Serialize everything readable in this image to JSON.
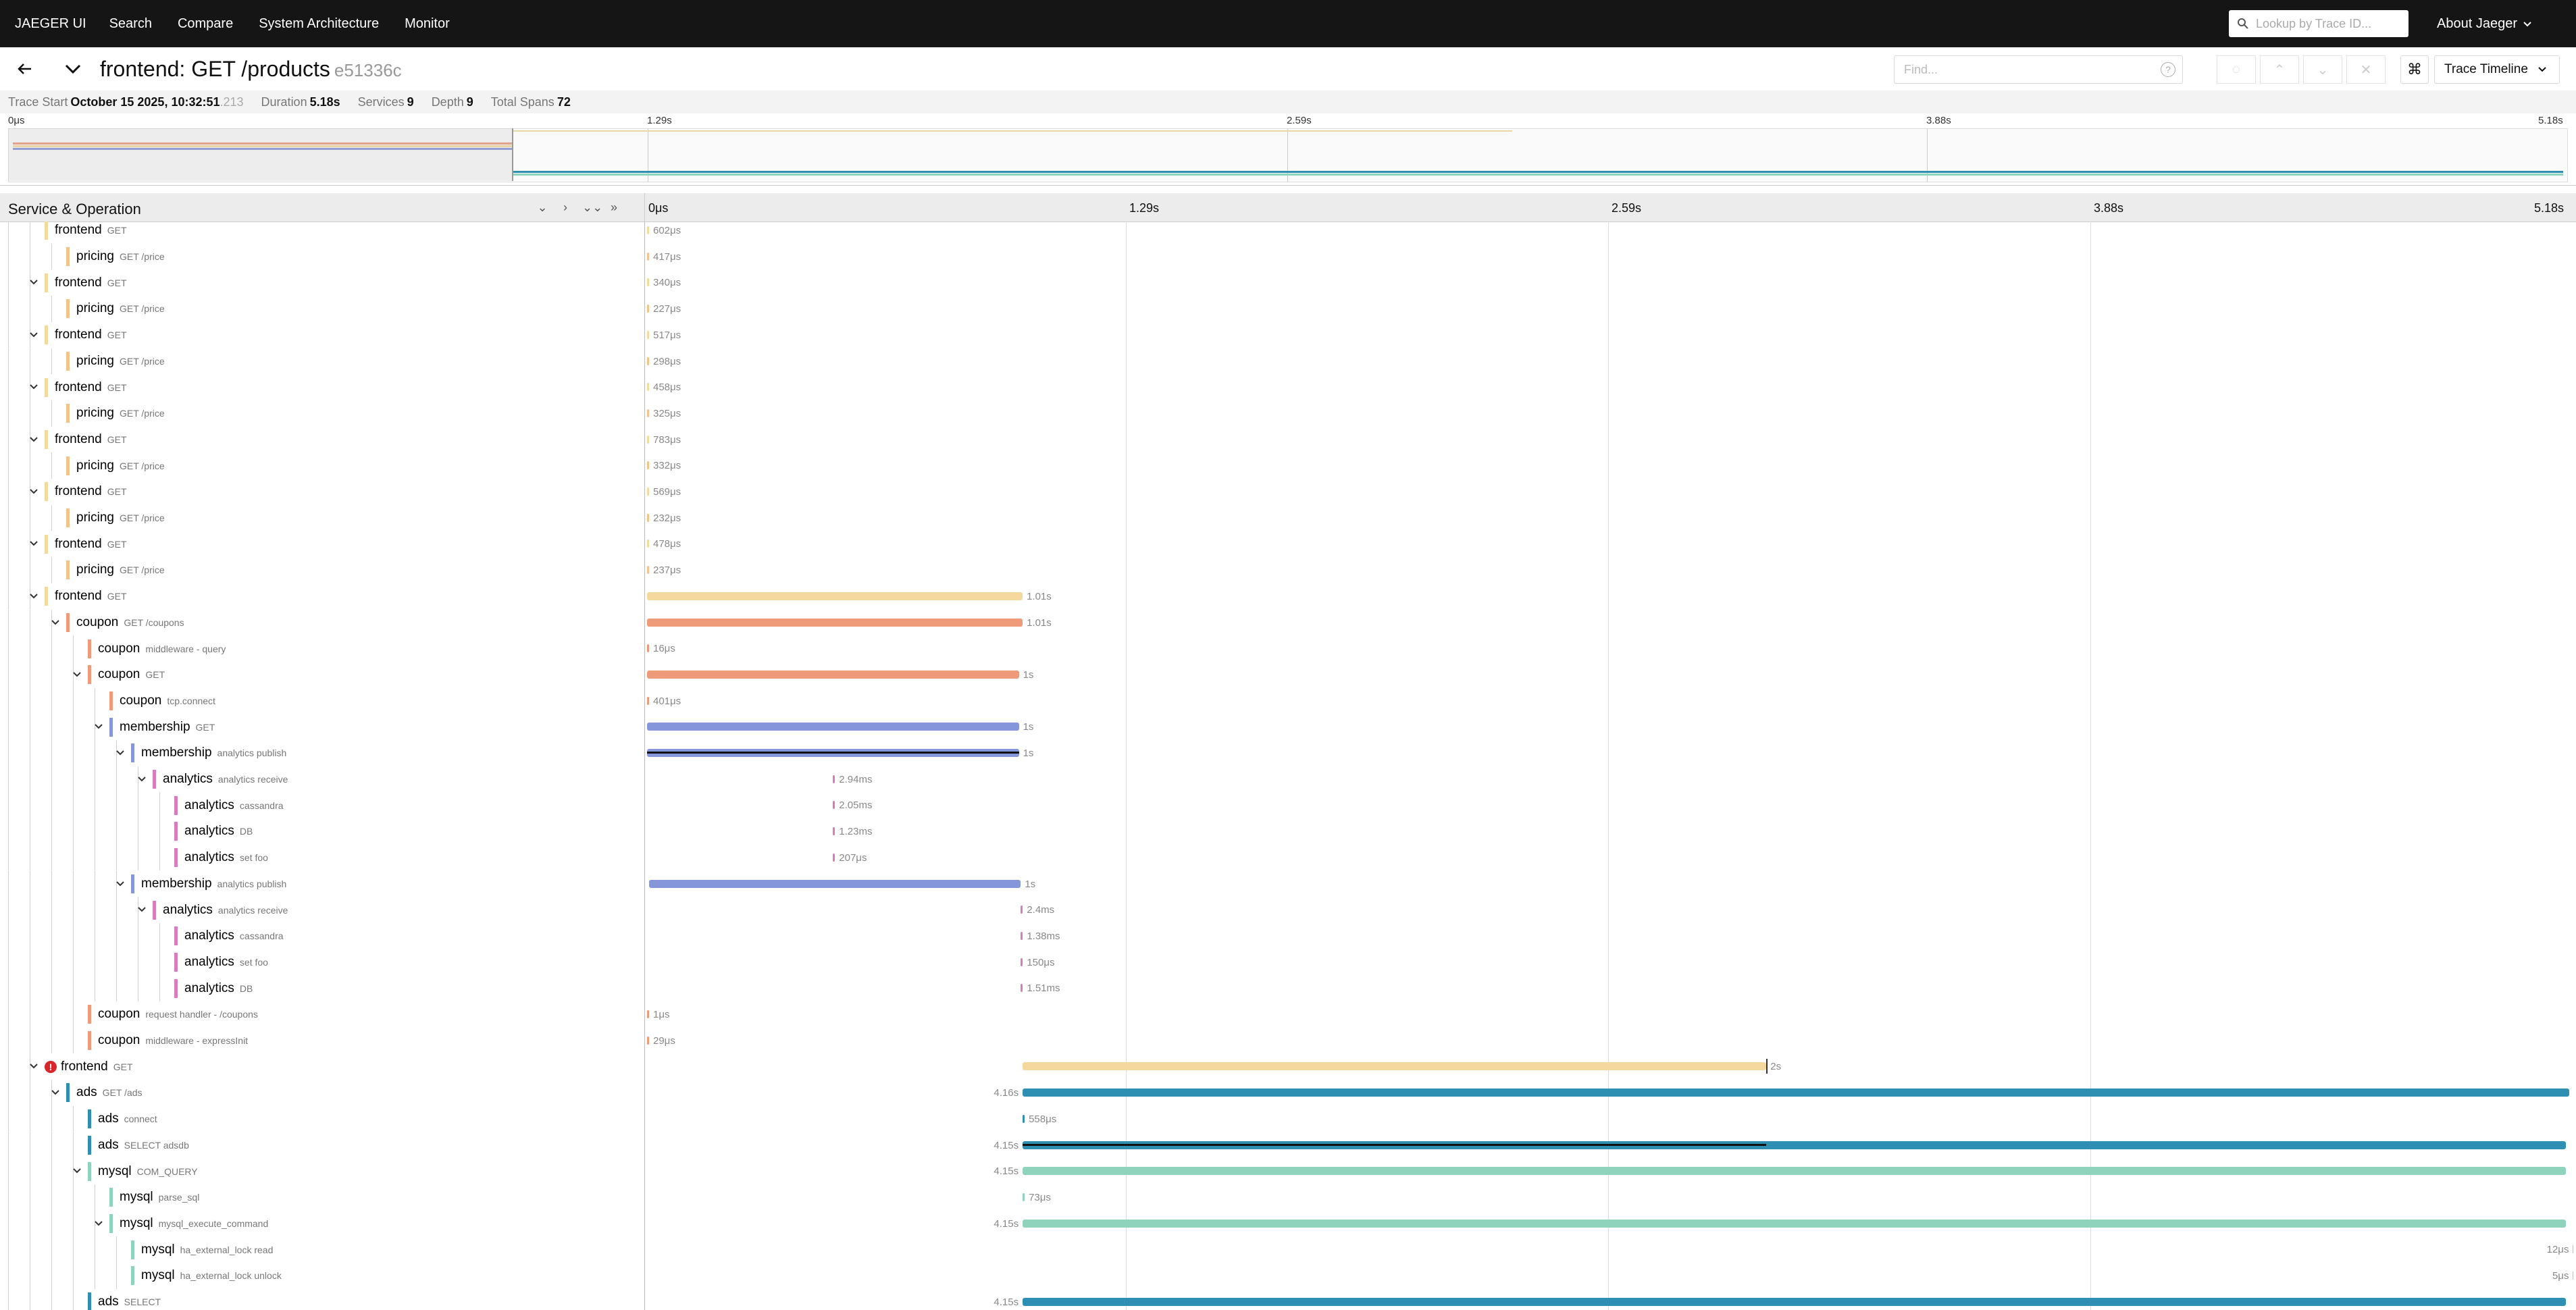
{
  "nav": {
    "brand": "JAEGER UI",
    "links": [
      "Search",
      "Compare",
      "System Architecture",
      "Monitor"
    ],
    "lookup_placeholder": "Lookup by Trace ID...",
    "about": "About Jaeger"
  },
  "trace": {
    "title": "frontend: GET /products",
    "trace_id": "e51336c",
    "find_placeholder": "Find...",
    "view_mode": "Trace Timeline"
  },
  "summary": {
    "trace_start_label": "Trace Start",
    "trace_start_value": "October 15 2025, 10:32:51",
    "trace_start_ms": ".213",
    "duration_label": "Duration",
    "duration_value": "5.18s",
    "services_label": "Services",
    "services_value": "9",
    "depth_label": "Depth",
    "depth_value": "9",
    "total_spans_label": "Total Spans",
    "total_spans_value": "72"
  },
  "timeline": {
    "ticks": [
      "0μs",
      "1.29s",
      "2.59s",
      "3.88s",
      "5.18s"
    ],
    "column_label": "Service & Operation",
    "total_seconds": 5.18
  },
  "colors": {
    "frontend": "#f5d89e",
    "pricing": "#f3c38a",
    "coupon": "#ef9b7a",
    "membership": "#8596db",
    "analytics": "#d97bc0",
    "ads": "#2e8fb3",
    "mysql": "#8fd3bd"
  },
  "rows": [
    {
      "service": "frontend",
      "op": "GET",
      "depth": 2,
      "toggle": "none",
      "start": 0.0,
      "dur_s": 0.000602,
      "label": "602μs",
      "clip": true
    },
    {
      "service": "pricing",
      "op": "GET /price",
      "depth": 3,
      "toggle": "none",
      "start": 0.0,
      "dur_s": 0.000417,
      "label": "417μs"
    },
    {
      "service": "frontend",
      "op": "GET",
      "depth": 2,
      "toggle": "open",
      "start": 0.0,
      "dur_s": 0.00034,
      "label": "340μs"
    },
    {
      "service": "pricing",
      "op": "GET /price",
      "depth": 3,
      "toggle": "none",
      "start": 0.0,
      "dur_s": 0.000227,
      "label": "227μs"
    },
    {
      "service": "frontend",
      "op": "GET",
      "depth": 2,
      "toggle": "open",
      "start": 0.0,
      "dur_s": 0.000517,
      "label": "517μs"
    },
    {
      "service": "pricing",
      "op": "GET /price",
      "depth": 3,
      "toggle": "none",
      "start": 0.0,
      "dur_s": 0.000298,
      "label": "298μs"
    },
    {
      "service": "frontend",
      "op": "GET",
      "depth": 2,
      "toggle": "open",
      "start": 0.0,
      "dur_s": 0.000458,
      "label": "458μs"
    },
    {
      "service": "pricing",
      "op": "GET /price",
      "depth": 3,
      "toggle": "none",
      "start": 0.0,
      "dur_s": 0.000325,
      "label": "325μs"
    },
    {
      "service": "frontend",
      "op": "GET",
      "depth": 2,
      "toggle": "open",
      "start": 0.0,
      "dur_s": 0.000783,
      "label": "783μs"
    },
    {
      "service": "pricing",
      "op": "GET /price",
      "depth": 3,
      "toggle": "none",
      "start": 0.0,
      "dur_s": 0.000332,
      "label": "332μs"
    },
    {
      "service": "frontend",
      "op": "GET",
      "depth": 2,
      "toggle": "open",
      "start": 0.0,
      "dur_s": 0.000569,
      "label": "569μs"
    },
    {
      "service": "pricing",
      "op": "GET /price",
      "depth": 3,
      "toggle": "none",
      "start": 0.0,
      "dur_s": 0.000232,
      "label": "232μs"
    },
    {
      "service": "frontend",
      "op": "GET",
      "depth": 2,
      "toggle": "open",
      "start": 0.0,
      "dur_s": 0.000478,
      "label": "478μs"
    },
    {
      "service": "pricing",
      "op": "GET /price",
      "depth": 3,
      "toggle": "none",
      "start": 0.0,
      "dur_s": 0.000237,
      "label": "237μs"
    },
    {
      "service": "frontend",
      "op": "GET",
      "depth": 2,
      "toggle": "open",
      "start": 0.0,
      "dur_s": 1.01,
      "label": "1.01s"
    },
    {
      "service": "coupon",
      "op": "GET /coupons",
      "depth": 3,
      "toggle": "open",
      "start": 0.0,
      "dur_s": 1.01,
      "label": "1.01s"
    },
    {
      "service": "coupon",
      "op": "middleware - query",
      "depth": 4,
      "toggle": "none",
      "start": 0.0,
      "dur_s": 1.6e-05,
      "label": "16μs"
    },
    {
      "service": "coupon",
      "op": "GET",
      "depth": 4,
      "toggle": "open",
      "start": 0.0,
      "dur_s": 1.0,
      "label": "1s"
    },
    {
      "service": "coupon",
      "op": "tcp.connect",
      "depth": 5,
      "toggle": "none",
      "start": 0.0,
      "dur_s": 0.000401,
      "label": "401μs"
    },
    {
      "service": "membership",
      "op": "GET",
      "depth": 5,
      "toggle": "open",
      "start": 0.0,
      "dur_s": 1.0,
      "label": "1s"
    },
    {
      "service": "membership",
      "op": "analytics publish",
      "depth": 6,
      "toggle": "open",
      "start": 0.0,
      "dur_s": 1.0,
      "label": "1s",
      "crit": true
    },
    {
      "service": "analytics",
      "op": "analytics receive",
      "depth": 7,
      "toggle": "open",
      "start": 0.5,
      "dur_s": 0.00294,
      "label": "2.94ms"
    },
    {
      "service": "analytics",
      "op": "cassandra",
      "depth": 8,
      "toggle": "none",
      "start": 0.5,
      "dur_s": 0.00205,
      "label": "2.05ms"
    },
    {
      "service": "analytics",
      "op": "DB",
      "depth": 8,
      "toggle": "none",
      "start": 0.5,
      "dur_s": 0.00123,
      "label": "1.23ms"
    },
    {
      "service": "analytics",
      "op": "set foo",
      "depth": 8,
      "toggle": "none",
      "start": 0.5,
      "dur_s": 0.000207,
      "label": "207μs"
    },
    {
      "service": "membership",
      "op": "analytics publish",
      "depth": 6,
      "toggle": "open",
      "start": 0.005,
      "dur_s": 1.0,
      "label": "1s"
    },
    {
      "service": "analytics",
      "op": "analytics receive",
      "depth": 7,
      "toggle": "open",
      "start": 1.005,
      "dur_s": 0.0024,
      "label": "2.4ms"
    },
    {
      "service": "analytics",
      "op": "cassandra",
      "depth": 8,
      "toggle": "none",
      "start": 1.005,
      "dur_s": 0.00138,
      "label": "1.38ms"
    },
    {
      "service": "analytics",
      "op": "set foo",
      "depth": 8,
      "toggle": "none",
      "start": 1.005,
      "dur_s": 0.00015,
      "label": "150μs"
    },
    {
      "service": "analytics",
      "op": "DB",
      "depth": 8,
      "toggle": "none",
      "start": 1.005,
      "dur_s": 0.00151,
      "label": "1.51ms"
    },
    {
      "service": "coupon",
      "op": "request handler - /coupons",
      "depth": 4,
      "toggle": "none",
      "start": 0.0,
      "dur_s": 1e-06,
      "label": "1μs"
    },
    {
      "service": "coupon",
      "op": "middleware - expressInit",
      "depth": 4,
      "toggle": "none",
      "start": 0.0,
      "dur_s": 2.9e-05,
      "label": "29μs"
    },
    {
      "service": "frontend",
      "op": "GET",
      "depth": 2,
      "toggle": "open",
      "start": 1.01,
      "dur_s": 2.0,
      "label": "2s",
      "error": true,
      "crit_end": true
    },
    {
      "service": "ads",
      "op": "GET /ads",
      "depth": 3,
      "toggle": "open",
      "start": 1.01,
      "dur_s": 4.16,
      "label": "4.16s",
      "label_left": true
    },
    {
      "service": "ads",
      "op": "connect",
      "depth": 4,
      "toggle": "none",
      "start": 1.01,
      "dur_s": 0.000558,
      "label": "558μs"
    },
    {
      "service": "ads",
      "op": "SELECT adsdb",
      "depth": 4,
      "toggle": "none",
      "start": 1.01,
      "dur_s": 4.15,
      "label": "4.15s",
      "label_left": true,
      "crit_part": 2.0
    },
    {
      "service": "mysql",
      "op": "COM_QUERY",
      "depth": 4,
      "toggle": "open",
      "start": 1.01,
      "dur_s": 4.15,
      "label": "4.15s",
      "label_left": true
    },
    {
      "service": "mysql",
      "op": "parse_sql",
      "depth": 5,
      "toggle": "none",
      "start": 1.01,
      "dur_s": 7.3e-05,
      "label": "73μs"
    },
    {
      "service": "mysql",
      "op": "mysql_execute_command",
      "depth": 5,
      "toggle": "open",
      "start": 1.01,
      "dur_s": 4.15,
      "label": "4.15s",
      "label_left": true
    },
    {
      "service": "mysql",
      "op": "ha_external_lock read",
      "depth": 6,
      "toggle": "none",
      "start": 5.179,
      "dur_s": 1.2e-05,
      "label": "12μs",
      "label_left": true
    },
    {
      "service": "mysql",
      "op": "ha_external_lock unlock",
      "depth": 6,
      "toggle": "none",
      "start": 5.179,
      "dur_s": 5e-06,
      "label": "5μs",
      "label_left": true
    },
    {
      "service": "ads",
      "op": "SELECT",
      "depth": 4,
      "toggle": "none",
      "start": 1.01,
      "dur_s": 4.15,
      "label": "4.15s",
      "label_left": true
    }
  ]
}
